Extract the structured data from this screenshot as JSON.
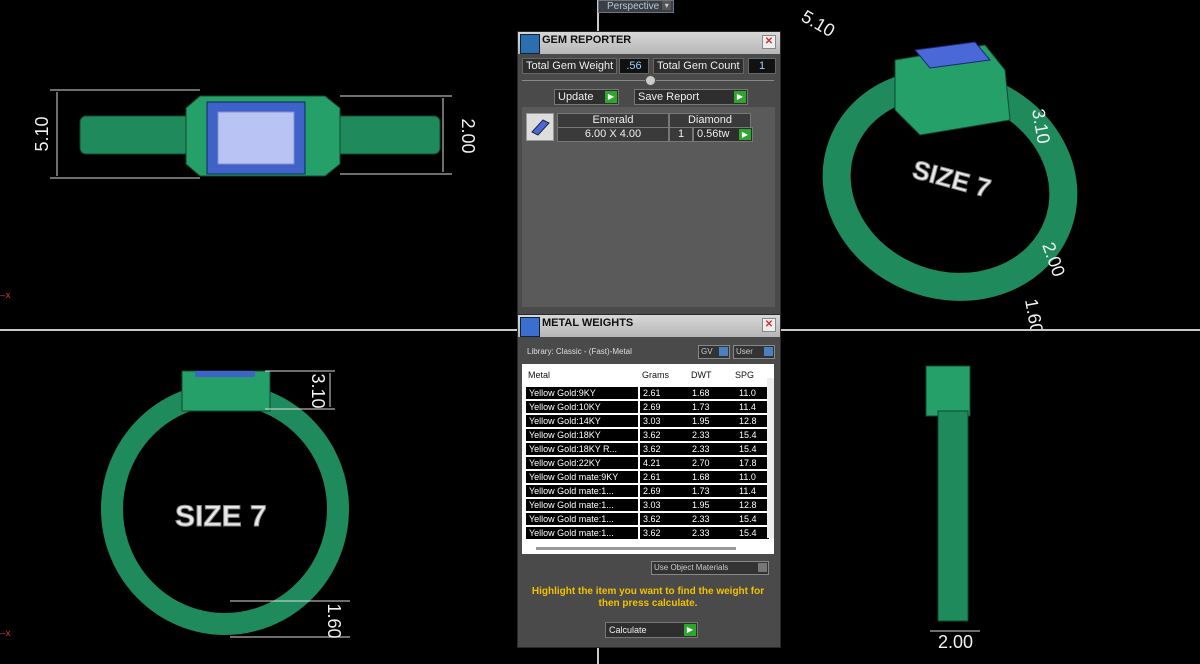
{
  "viewport": {
    "view_mode": "Perspective",
    "axis_x": "x"
  },
  "views": {
    "top": {
      "dim_left": "5.10",
      "dim_right": "2.00"
    },
    "perspective": {
      "dim_top": "5.10",
      "dim_mid": "3.10",
      "dim_band": "2.00",
      "dim_bottom": "1.60",
      "size_text": "SIZE 7"
    },
    "front": {
      "dim_top": "3.10",
      "dim_bottom": "1.60",
      "size_text": "SIZE 7"
    },
    "side": {
      "dim_bottom": "2.00"
    }
  },
  "gem_reporter": {
    "title": "GEM REPORTER",
    "total_gem_weight_label": "Total Gem Weight",
    "total_gem_weight_value": ".56",
    "total_gem_count_label": "Total Gem Count",
    "total_gem_count_value": "1",
    "update_label": "Update",
    "save_report_label": "Save Report",
    "table": {
      "col_shape": "Emerald",
      "col_type": "Diamond",
      "size": "6.00 X 4.00",
      "qty": "1",
      "weight": "0.56tw"
    }
  },
  "metal_weights": {
    "title": "METAL WEIGHTS",
    "library": "Library: Classic - (Fast)-Metal",
    "gv_label": "GV",
    "user_label": "User",
    "columns": [
      "Metal",
      "Grams",
      "DWT",
      "SPG"
    ],
    "rows": [
      [
        "Yellow Gold:9KY",
        "2.61",
        "1.68",
        "11.0"
      ],
      [
        "Yellow Gold:10KY",
        "2.69",
        "1.73",
        "11.4"
      ],
      [
        "Yellow Gold:14KY",
        "3.03",
        "1.95",
        "12.8"
      ],
      [
        "Yellow Gold:18KY",
        "3.62",
        "2.33",
        "15.4"
      ],
      [
        "Yellow Gold:18KY R...",
        "3.62",
        "2.33",
        "15.4"
      ],
      [
        "Yellow Gold:22KY",
        "4.21",
        "2.70",
        "17.8"
      ],
      [
        "Yellow Gold mate:9KY",
        "2.61",
        "1.68",
        "11.0"
      ],
      [
        "Yellow Gold mate:1...",
        "2.69",
        "1.73",
        "11.4"
      ],
      [
        "Yellow Gold mate:1...",
        "3.03",
        "1.95",
        "12.8"
      ],
      [
        "Yellow Gold mate:1...",
        "3.62",
        "2.33",
        "15.4"
      ],
      [
        "Yellow Gold mate:1...",
        "3.62",
        "2.33",
        "15.4"
      ]
    ],
    "use_object_materials": "Use Object Materials",
    "hint": "Highlight the item you want to find the weight for then press calculate.",
    "calculate_label": "Calculate"
  },
  "colors": {
    "ring_green": "#1f8a5c",
    "gem_blue": "#5b74e0",
    "hint_yellow": "#f2c200",
    "accent_go": "#2ea52e"
  }
}
